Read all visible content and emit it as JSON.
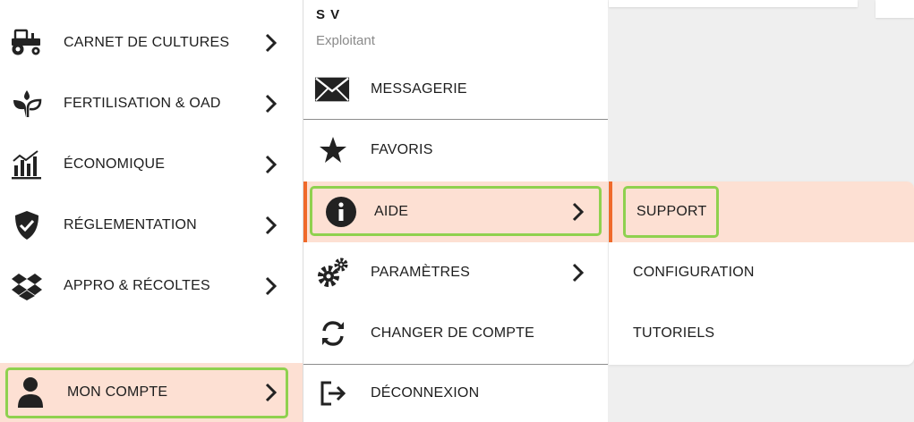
{
  "main_menu": {
    "items": [
      {
        "label": "CARNET DE CULTURES",
        "icon": "tractor-icon"
      },
      {
        "label": "FERTILISATION & OAD",
        "icon": "seedling-icon"
      },
      {
        "label": "ÉCONOMIQUE",
        "icon": "bar-chart-icon"
      },
      {
        "label": "RÉGLEMENTATION",
        "icon": "shield-check-icon"
      },
      {
        "label": "APPRO & RÉCOLTES",
        "icon": "dropbox-icon"
      }
    ],
    "account": {
      "label": "MON COMPTE",
      "icon": "user-icon"
    }
  },
  "account_menu": {
    "user_name": "S V",
    "user_role": "Exploitant",
    "items": [
      {
        "label": "MESSAGERIE",
        "icon": "envelope-icon"
      },
      {
        "label": "FAVORIS",
        "icon": "star-icon"
      },
      {
        "label": "AIDE",
        "icon": "info-icon"
      },
      {
        "label": "PARAMÈTRES",
        "icon": "gears-icon"
      },
      {
        "label": "CHANGER DE COMPTE",
        "icon": "sync-icon"
      },
      {
        "label": "DÉCONNEXION",
        "icon": "sign-out-icon"
      }
    ]
  },
  "help_menu": {
    "items": [
      {
        "label": "SUPPORT"
      },
      {
        "label": "CONFIGURATION"
      },
      {
        "label": "TUTORIELS"
      }
    ]
  },
  "colors": {
    "active_background": "#fde0d3",
    "active_accent": "#f06a2a",
    "highlight_outline": "#8fd14f"
  }
}
